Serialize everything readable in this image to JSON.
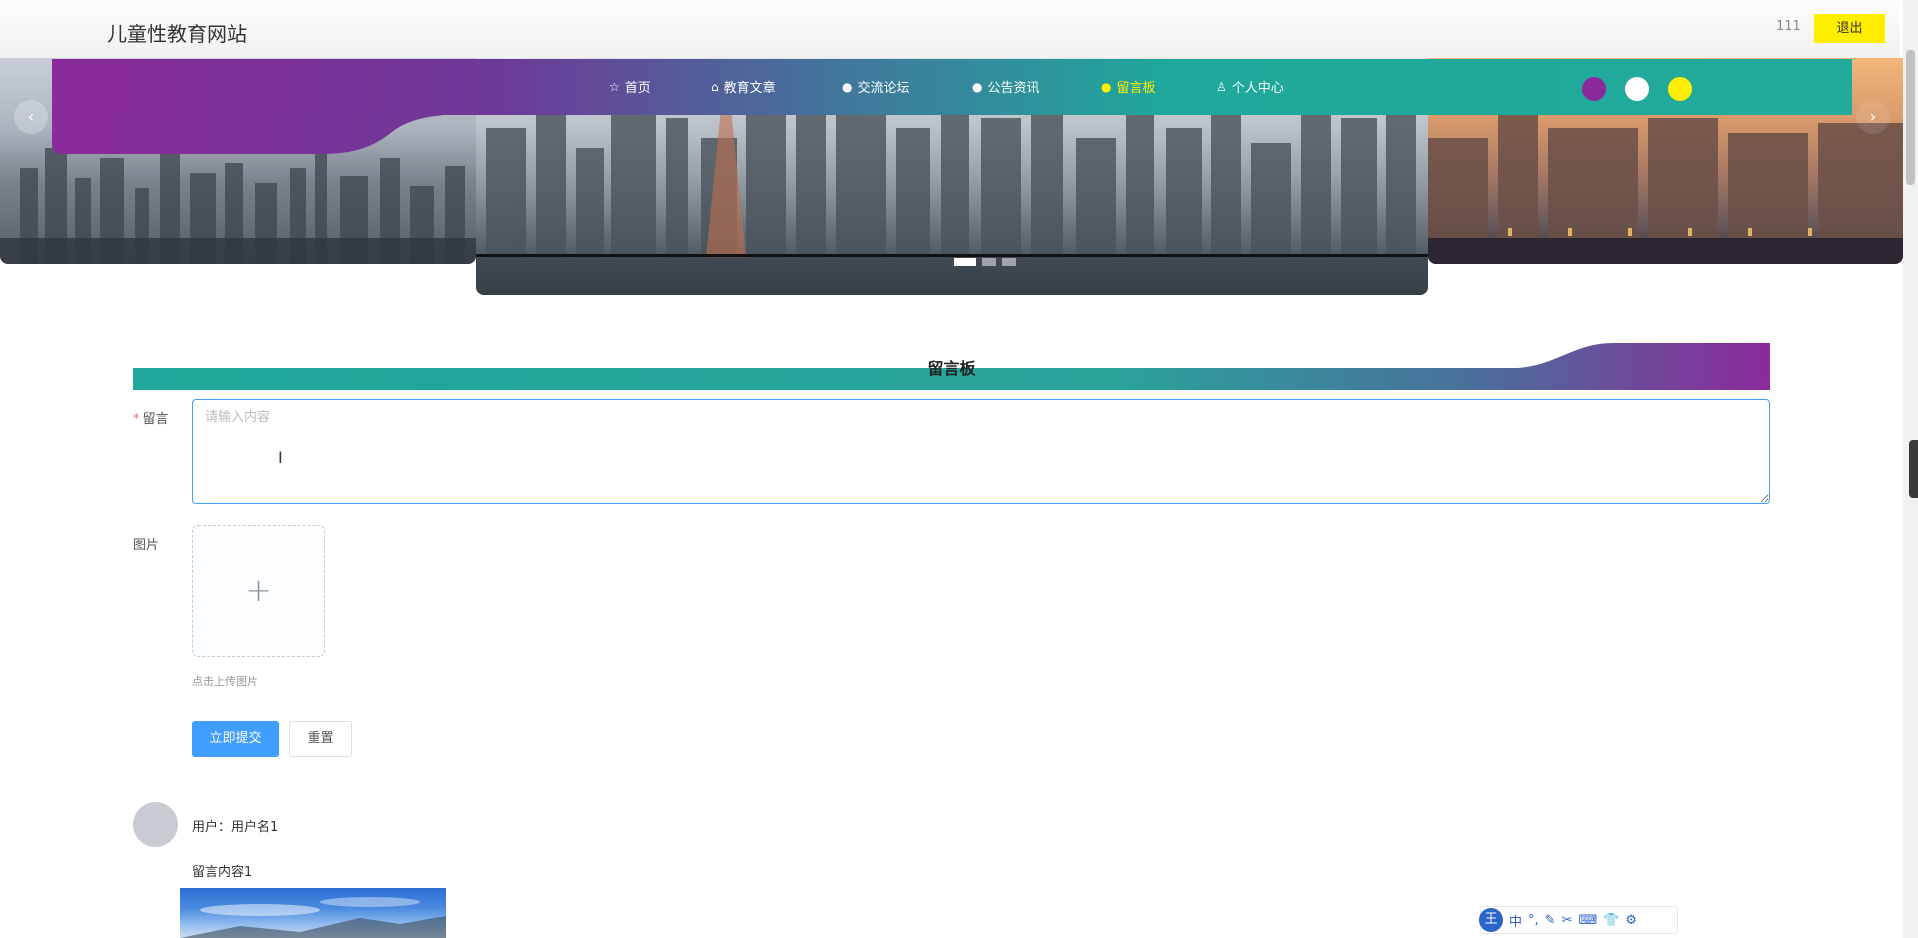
{
  "header": {
    "site_title": "儿童性教育网站",
    "user_name": "111",
    "logout_label": "退出"
  },
  "nav": {
    "items": [
      {
        "label": "首页",
        "icon": "star-icon",
        "glyph": "☆",
        "active": false
      },
      {
        "label": "教育文章",
        "icon": "bag-icon",
        "glyph": "⌂",
        "active": false
      },
      {
        "label": "交流论坛",
        "icon": "info-circle-icon",
        "glyph": "●",
        "active": false
      },
      {
        "label": "公告资讯",
        "icon": "info-circle-icon",
        "glyph": "●",
        "active": false
      },
      {
        "label": "留言板",
        "icon": "info-circle-icon",
        "glyph": "●",
        "active": true
      },
      {
        "label": "个人中心",
        "icon": "user-icon",
        "glyph": "♙",
        "active": false
      }
    ],
    "theme_colors": [
      "#8b2a9a",
      "#ffffff",
      "#ffee00"
    ],
    "active_color": "#ffee00"
  },
  "carousel": {
    "prev_glyph": "‹",
    "next_glyph": "›",
    "slide_count": 3,
    "active_index": 0
  },
  "section": {
    "title": "留言板"
  },
  "form": {
    "message_label": "留言",
    "message_required": "*",
    "message_placeholder": "请输入内容",
    "image_label": "图片",
    "upload_plus": "+",
    "upload_tip": "点击上传图片",
    "submit_label": "立即提交",
    "reset_label": "重置"
  },
  "comments": [
    {
      "user_line": "用户：用户名1",
      "content": "留言内容1"
    }
  ],
  "ime_toolbar": {
    "logo": "王",
    "items": [
      "中",
      "°,",
      "✎",
      "✂",
      "⌨",
      "👕",
      "⚙"
    ]
  }
}
